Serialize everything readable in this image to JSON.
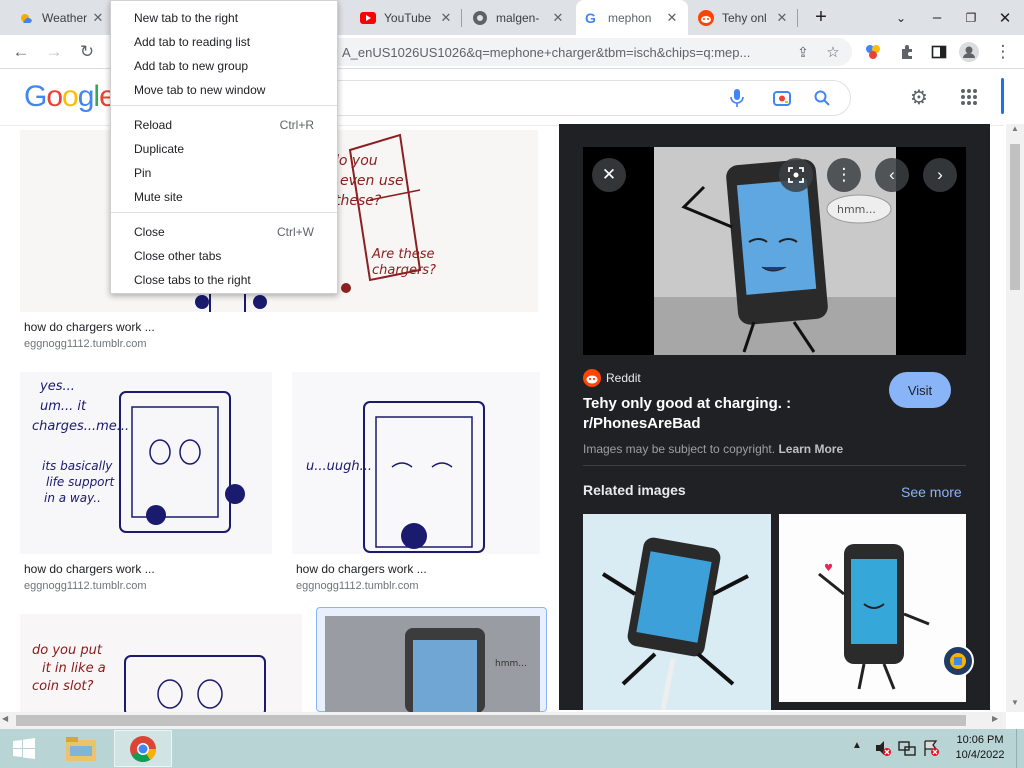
{
  "tabs": [
    {
      "label": "Weather",
      "favicon": "weather-icon"
    },
    {
      "label": "YouTube",
      "favicon": "youtube-icon"
    },
    {
      "label": "malgen-",
      "favicon": "globe-icon"
    },
    {
      "label": "mephon",
      "favicon": "google-icon"
    },
    {
      "label": "Tehy onl",
      "favicon": "reddit-icon"
    }
  ],
  "omnibox": {
    "url": "A_enUS1026US1026&q=mephone+charger&tbm=isch&chips=q:mep..."
  },
  "google": {
    "logo": "Google"
  },
  "context_menu": {
    "group1": [
      "New tab to the right",
      "Add tab to reading list",
      "Add tab to new group",
      "Move tab to new window"
    ],
    "group2": [
      {
        "label": "Reload",
        "shortcut": "Ctrl+R"
      },
      {
        "label": "Duplicate",
        "shortcut": ""
      },
      {
        "label": "Pin",
        "shortcut": ""
      },
      {
        "label": "Mute site",
        "shortcut": ""
      }
    ],
    "group3": [
      {
        "label": "Close",
        "shortcut": "Ctrl+W"
      },
      {
        "label": "Close other tabs",
        "shortcut": ""
      },
      {
        "label": "Close tabs to the right",
        "shortcut": ""
      }
    ]
  },
  "results": [
    {
      "caption": "how do chargers work ...",
      "source": "eggnogg1112.tumblr.com",
      "art_text": "do you even use these? Are these chargers?"
    },
    {
      "caption": "how do chargers work ...",
      "source": "eggnogg1112.tumblr.com",
      "art_text": "yes... um... it charges...me... its basically life support in a way..."
    },
    {
      "caption": "how do chargers work ...",
      "source": "eggnogg1112.tumblr.com",
      "art_text": "u...uugh..."
    },
    {
      "caption": "",
      "source": "",
      "art_text": "do you put it in like a coin slot?"
    },
    {
      "caption": "",
      "source": "",
      "art_text": "hmm..."
    }
  ],
  "panel": {
    "site": "Reddit",
    "title": "Tehy only good at charging. : r/PhonesAreBad",
    "visit": "Visit",
    "copyright": "Images may be subject to copyright.",
    "learn_more": "Learn More",
    "related": "Related images",
    "see_more": "See more",
    "preview_text": "hmm..."
  },
  "taskbar": {
    "time": "10:06 PM",
    "date": "10/4/2022"
  }
}
